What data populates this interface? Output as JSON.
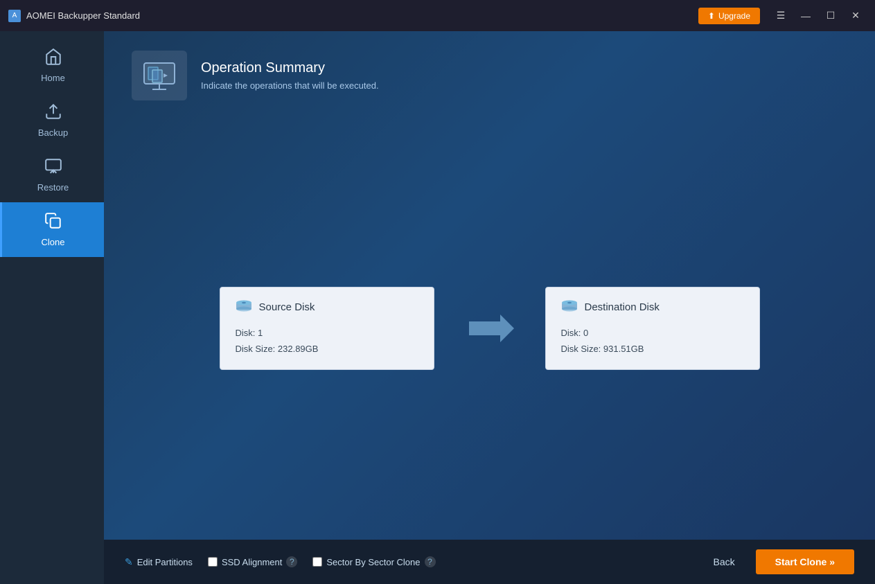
{
  "titlebar": {
    "title": "AOMEI Backupper Standard",
    "upgrade_label": "Upgrade"
  },
  "sidebar": {
    "items": [
      {
        "id": "home",
        "label": "Home",
        "icon": "🏠",
        "active": false
      },
      {
        "id": "backup",
        "label": "Backup",
        "icon": "📤",
        "active": false
      },
      {
        "id": "restore",
        "label": "Restore",
        "icon": "↩",
        "active": false
      },
      {
        "id": "clone",
        "label": "Clone",
        "icon": "⧉",
        "active": true
      }
    ]
  },
  "header": {
    "title": "Operation Summary",
    "subtitle": "Indicate the operations that will be executed."
  },
  "source_disk": {
    "label": "Source Disk",
    "disk_number": "Disk: 1",
    "disk_size": "Disk Size: 232.89GB"
  },
  "destination_disk": {
    "label": "Destination Disk",
    "disk_number": "Disk: 0",
    "disk_size": "Disk Size: 931.51GB"
  },
  "footer": {
    "edit_partitions_label": "Edit Partitions",
    "ssd_alignment_label": "SSD Alignment",
    "sector_by_sector_label": "Sector By Sector Clone",
    "back_label": "Back",
    "start_clone_label": "Start Clone »"
  },
  "controls": {
    "minimize": "—",
    "maximize": "☐",
    "close": "✕",
    "menu": "☰"
  }
}
